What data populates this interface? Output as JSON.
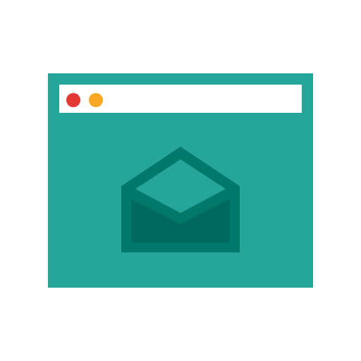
{
  "window": {
    "background_color": "#26A69A",
    "titlebar": {
      "background_color": "#FFFFFF",
      "buttons": [
        {
          "icon": "close-dot-icon",
          "color": "#E53935"
        },
        {
          "icon": "minimize-dot-icon",
          "color": "#F9A825"
        }
      ]
    },
    "content": {
      "icon": "open-envelope-icon",
      "colors": {
        "outline": "#00796B",
        "flap": "#26A69A",
        "inner": "#00695C"
      }
    }
  }
}
